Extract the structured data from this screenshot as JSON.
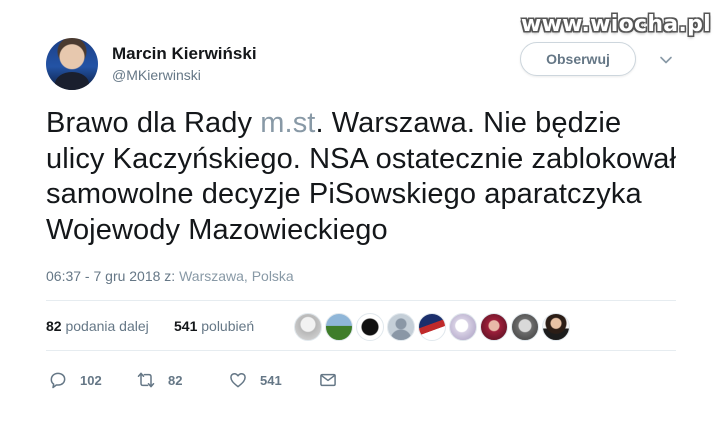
{
  "watermark": "www.wiocha.pl",
  "author": {
    "name": "Marcin Kierwiński",
    "handle": "@MKierwinski",
    "follow_label": "Obserwuj"
  },
  "tweet": {
    "text_part1": "Brawo dla Rady ",
    "link": "m.st",
    "text_part2": ". Warszawa. Nie będzie ulicy Kaczyńskiego. NSA ostatecznie zablokował samowolne decyzje PiSowskiego aparatczyka Wojewody Mazowieckiego"
  },
  "meta": {
    "datetime": "06:37 - 7 gru 2018 z: ",
    "location": "Warszawa, Polska"
  },
  "stats": {
    "retweets_count": "82",
    "retweets_label": "podania dalej",
    "likes_count": "541",
    "likes_label": "polubień"
  },
  "likers": [
    "liker-avatar-1",
    "liker-avatar-2",
    "liker-avatar-3",
    "liker-avatar-4",
    "liker-avatar-5",
    "liker-avatar-6",
    "liker-avatar-7",
    "liker-avatar-8",
    "liker-avatar-9"
  ],
  "actions": {
    "reply_count": "102",
    "retweet_count": "82",
    "like_count": "541"
  },
  "colors": {
    "text": "#14171a",
    "muted": "#657786",
    "link": "#8899a6",
    "border": "#e6ecf0"
  }
}
